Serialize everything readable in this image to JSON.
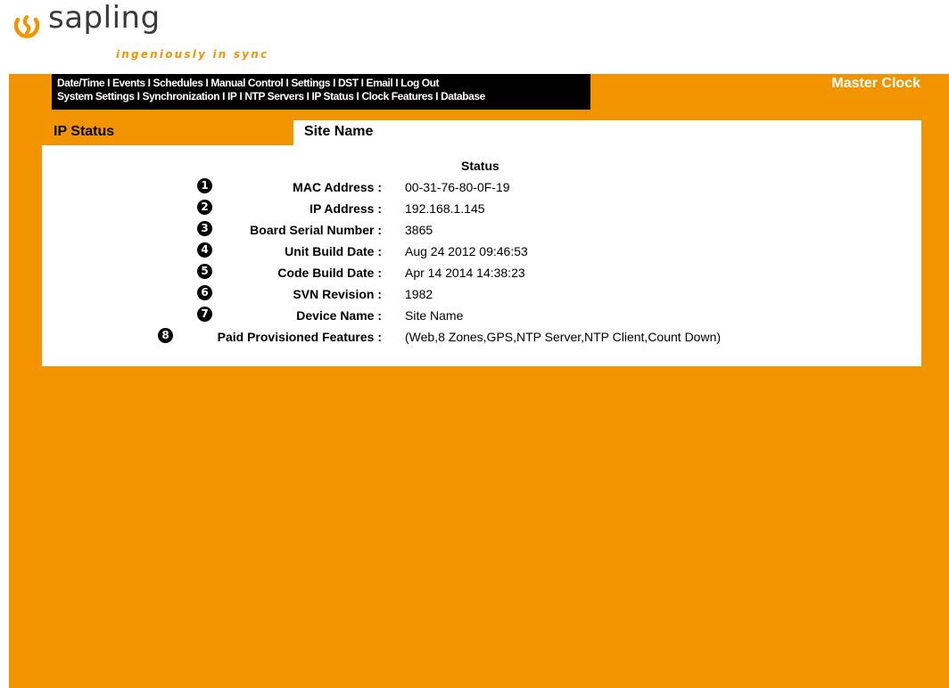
{
  "logo": {
    "brand": "sapling",
    "tagline": "ingeniously in sync"
  },
  "nav": {
    "row1": [
      "Date/Time",
      "Events",
      "Schedules",
      "Manual Control",
      "Settings",
      "DST",
      "Email",
      "Log Out"
    ],
    "row2": [
      "System Settings",
      "Synchronization",
      "IP",
      "NTP Servers",
      "IP Status",
      "Clock Features",
      "Database"
    ],
    "separator": "I"
  },
  "header": {
    "device_type": "Master Clock",
    "page_title": "IP Status",
    "site_name": "Site Name"
  },
  "status": {
    "heading": "Status",
    "rows": [
      {
        "num": "1",
        "label": "MAC Address :",
        "value": "00-31-76-80-0F-19"
      },
      {
        "num": "2",
        "label": "IP Address :",
        "value": "192.168.1.145"
      },
      {
        "num": "3",
        "label": "Board Serial Number :",
        "value": "3865"
      },
      {
        "num": "4",
        "label": "Unit Build Date :",
        "value": "Aug 24 2012 09:46:53"
      },
      {
        "num": "5",
        "label": "Code Build Date :",
        "value": "Apr 14 2014 14:38:23"
      },
      {
        "num": "6",
        "label": "SVN Revision :",
        "value": "1982"
      },
      {
        "num": "7",
        "label": "Device Name :",
        "value": "Site Name"
      },
      {
        "num": "8",
        "label": "Paid Provisioned Features :",
        "value": "(Web,8 Zones,GPS,NTP Server,NTP Client,Count Down)"
      }
    ]
  },
  "colors": {
    "accent": "#f29400",
    "nav_bg": "#000000",
    "panel_bg": "#ffffff"
  }
}
